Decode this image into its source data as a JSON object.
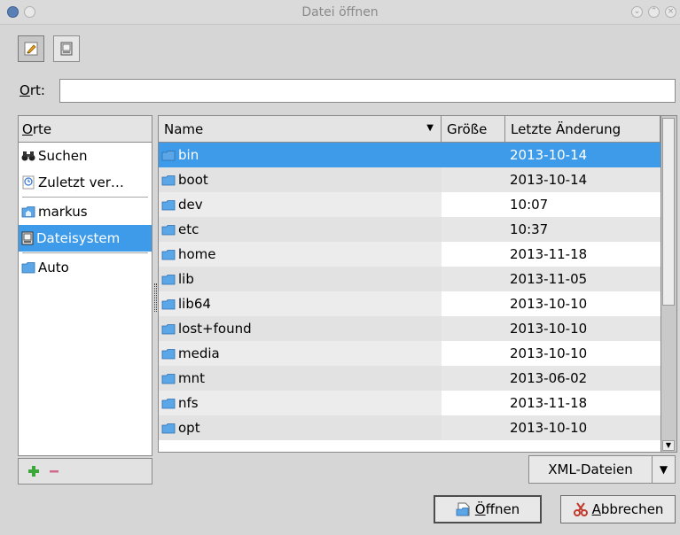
{
  "window": {
    "title": "Datei öffnen"
  },
  "location": {
    "label_key": "O",
    "label_rest": "rt:",
    "value": ""
  },
  "places": {
    "header_key": "O",
    "header_rest": "rte",
    "items": [
      {
        "label": "Suchen",
        "icon": "binoculars-icon"
      },
      {
        "label": "Zuletzt ver…",
        "icon": "recent-icon"
      },
      {
        "label": "markus",
        "icon": "home-folder-icon"
      },
      {
        "label": "Dateisystem",
        "icon": "drive-icon"
      },
      {
        "label": "Auto",
        "icon": "folder-icon"
      }
    ]
  },
  "files": {
    "columns": {
      "name": "Name",
      "size": "Größe",
      "date": "Letzte Änderung"
    },
    "rows": [
      {
        "name": "bin",
        "date": "2013-10-14"
      },
      {
        "name": "boot",
        "date": "2013-10-14"
      },
      {
        "name": "dev",
        "date": "10:07"
      },
      {
        "name": "etc",
        "date": "10:37"
      },
      {
        "name": "home",
        "date": "2013-11-18"
      },
      {
        "name": "lib",
        "date": "2013-11-05"
      },
      {
        "name": "lib64",
        "date": "2013-10-10"
      },
      {
        "name": "lost+found",
        "date": "2013-10-10"
      },
      {
        "name": "media",
        "date": "2013-10-10"
      },
      {
        "name": "mnt",
        "date": "2013-06-02"
      },
      {
        "name": "nfs",
        "date": "2013-11-18"
      },
      {
        "name": "opt",
        "date": "2013-10-10"
      }
    ]
  },
  "filter": {
    "value": "XML-Dateien"
  },
  "buttons": {
    "open_key": "Ö",
    "open_rest": "ffnen",
    "cancel_key": "A",
    "cancel_rest": "bbrechen"
  },
  "colors": {
    "selection": "#3d9be9",
    "folder": "#5aa6e6"
  }
}
